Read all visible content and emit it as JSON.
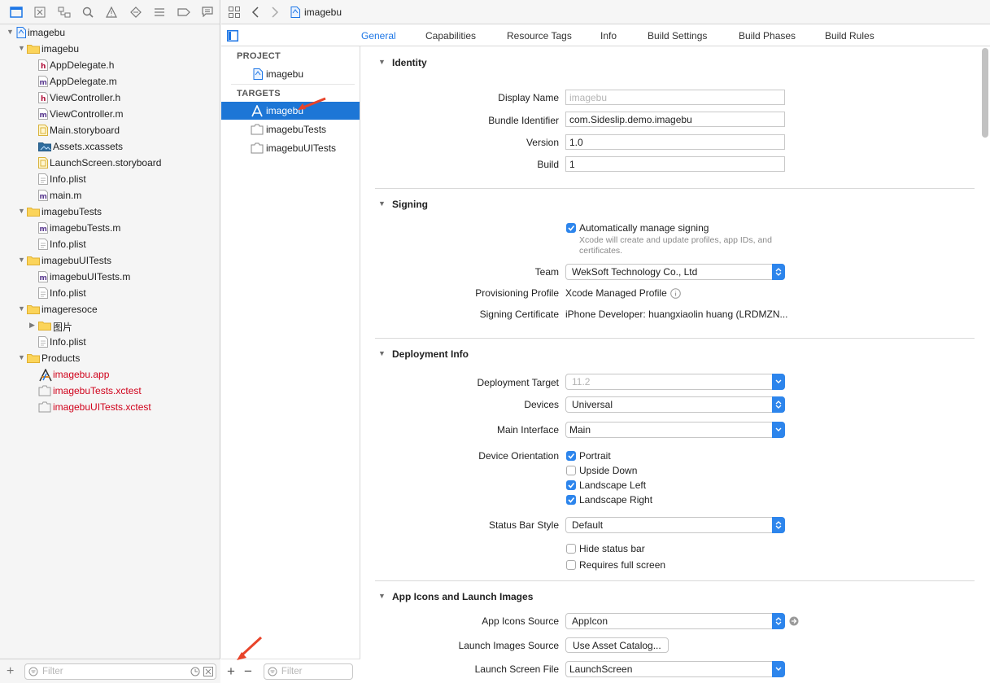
{
  "navigator": {
    "tree": [
      {
        "label": "imagebu",
        "icon": "project-icon",
        "indent": 0,
        "disclosure": "open"
      },
      {
        "label": "imagebu",
        "icon": "folder-icon",
        "indent": 1,
        "disclosure": "open"
      },
      {
        "label": "AppDelegate.h",
        "icon": "header-file-icon",
        "indent": 2
      },
      {
        "label": "AppDelegate.m",
        "icon": "objc-file-icon",
        "indent": 2
      },
      {
        "label": "ViewController.h",
        "icon": "header-file-icon",
        "indent": 2
      },
      {
        "label": "ViewController.m",
        "icon": "objc-file-icon",
        "indent": 2
      },
      {
        "label": "Main.storyboard",
        "icon": "storyboard-icon",
        "indent": 2
      },
      {
        "label": "Assets.xcassets",
        "icon": "asset-catalog-icon",
        "indent": 2
      },
      {
        "label": "LaunchScreen.storyboard",
        "icon": "storyboard-icon",
        "indent": 2
      },
      {
        "label": "Info.plist",
        "icon": "plist-icon",
        "indent": 2
      },
      {
        "label": "main.m",
        "icon": "objc-file-icon",
        "indent": 2
      },
      {
        "label": "imagebuTests",
        "icon": "folder-icon",
        "indent": 1,
        "disclosure": "open"
      },
      {
        "label": "imagebuTests.m",
        "icon": "objc-file-icon",
        "indent": 2
      },
      {
        "label": "Info.plist",
        "icon": "plist-icon",
        "indent": 2
      },
      {
        "label": "imagebuUITests",
        "icon": "folder-icon",
        "indent": 1,
        "disclosure": "open"
      },
      {
        "label": "imagebuUITests.m",
        "icon": "objc-file-icon",
        "indent": 2
      },
      {
        "label": "Info.plist",
        "icon": "plist-icon",
        "indent": 2
      },
      {
        "label": "imageresoce",
        "icon": "folder-icon",
        "indent": 1,
        "disclosure": "open"
      },
      {
        "label": "图片",
        "icon": "folder-icon",
        "indent": 2,
        "disclosure": "closed"
      },
      {
        "label": "Info.plist",
        "icon": "plist-icon",
        "indent": 2
      },
      {
        "label": "Products",
        "icon": "folder-icon",
        "indent": 1,
        "disclosure": "open"
      },
      {
        "label": "imagebu.app",
        "icon": "app-icon",
        "indent": 2,
        "red": true
      },
      {
        "label": "imagebuTests.xctest",
        "icon": "bundle-icon",
        "indent": 2,
        "red": true
      },
      {
        "label": "imagebuUITests.xctest",
        "icon": "bundle-icon",
        "indent": 2,
        "red": true
      }
    ],
    "filter_placeholder": "Filter"
  },
  "jumpbar": {
    "title": "imagebu"
  },
  "tabs": [
    "General",
    "Capabilities",
    "Resource Tags",
    "Info",
    "Build Settings",
    "Build Phases",
    "Build Rules"
  ],
  "selected_tab": "General",
  "targets_pane": {
    "project_header": "PROJECT",
    "project_item": "imagebu",
    "targets_header": "TARGETS",
    "targets": [
      "imagebu",
      "imagebuTests",
      "imagebuUITests"
    ],
    "selected_target": "imagebu",
    "filter_placeholder": "Filter"
  },
  "identity": {
    "title": "Identity",
    "display_name_label": "Display Name",
    "display_name_placeholder": "imagebu",
    "bundle_id_label": "Bundle Identifier",
    "bundle_id": "com.Sideslip.demo.imagebu",
    "version_label": "Version",
    "version": "1.0",
    "build_label": "Build",
    "build": "1"
  },
  "signing": {
    "title": "Signing",
    "auto_manage": "Automatically manage signing",
    "auto_manage_checked": true,
    "auto_manage_note_1": "Xcode will create and update profiles, app IDs, and",
    "auto_manage_note_2": "certificates.",
    "team_label": "Team",
    "team": "WekSoft Technology Co., Ltd",
    "profile_label": "Provisioning Profile",
    "profile": "Xcode Managed Profile",
    "cert_label": "Signing Certificate",
    "cert": "iPhone Developer: huangxiaolin huang (LRDMZN..."
  },
  "deployment": {
    "title": "Deployment Info",
    "target_label": "Deployment Target",
    "target": "11.2",
    "devices_label": "Devices",
    "devices": "Universal",
    "interface_label": "Main Interface",
    "interface": "Main",
    "orientation_label": "Device Orientation",
    "orientations": [
      {
        "label": "Portrait",
        "checked": true
      },
      {
        "label": "Upside Down",
        "checked": false
      },
      {
        "label": "Landscape Left",
        "checked": true
      },
      {
        "label": "Landscape Right",
        "checked": true
      }
    ],
    "status_label": "Status Bar Style",
    "status": "Default",
    "hide_status": "Hide status bar",
    "hide_status_checked": false,
    "full_screen": "Requires full screen",
    "full_screen_checked": false
  },
  "icons": {
    "title": "App Icons and Launch Images",
    "icons_source_label": "App Icons Source",
    "icons_source": "AppIcon",
    "launch_images_label": "Launch Images Source",
    "launch_images_button": "Use Asset Catalog...",
    "launch_file_label": "Launch Screen File",
    "launch_file": "LaunchScreen"
  },
  "colors": {
    "accent": "#1d76d6",
    "red_text": "#d0021b",
    "arrow": "#e8442a"
  }
}
